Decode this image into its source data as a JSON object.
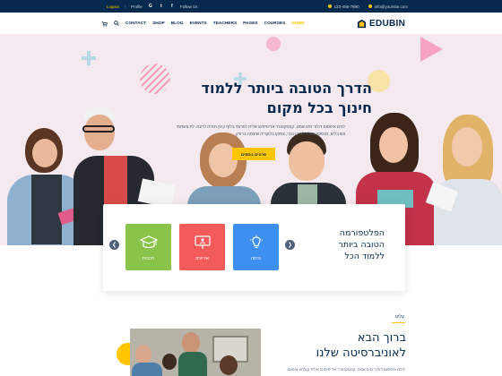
{
  "topbar": {
    "logout": "Logout",
    "profile": "Profile",
    "follow": "Follow Us",
    "phone": "123-456-7890",
    "email": "info@yoursite.com"
  },
  "nav": {
    "items": [
      "CONTACT",
      "SHOP",
      "BLOG",
      "EVENTS",
      "TEACHERS",
      "PAGES",
      "COURSES",
      "HOME"
    ],
    "active": "HOME"
  },
  "logo": {
    "text": "EDUBIN"
  },
  "hero": {
    "title_line1": "הדרך הטובה ביותר ללמוד",
    "title_line2": "חינוך בכל מקום",
    "text_line1": "לורם איפסום דולור סיט אמט, קונסקטורר אדיפיסינג אלית לפרומי בלוף קינץ תתיח לרעח. לת צשחמי",
    "text_line2": "צש בליא, מנסוטו צמלח לביקו ננבי, צמוקו בלוקריה שיצמה ברורק",
    "button": "פרטים נוספים"
  },
  "categories": {
    "text_line1": "הפלטפורמה",
    "text_line2": "הטובה ביותר",
    "text_line3": "ללמוד הכל",
    "items": [
      {
        "label": "כניסה",
        "color": "#3d8ff0",
        "icon": "lightbulb-icon"
      },
      {
        "label": "אירועים",
        "color": "#f35a5a",
        "icon": "presentation-icon"
      },
      {
        "label": "תכניות",
        "color": "#8ac34a",
        "icon": "graduation-cap-icon"
      }
    ]
  },
  "about": {
    "kicker": "עלינו",
    "title_line1": "ברוך הבא",
    "title_line2": "לאוניברסיטה שלנו",
    "text": "לורם איפסום דולור סיט אמט, קונסקטורר אדיפיסינג אלית קולהע צופעט"
  },
  "colors": {
    "navy": "#07294d",
    "accent": "#ffc600",
    "hero_bg": "#f3e9ee"
  }
}
